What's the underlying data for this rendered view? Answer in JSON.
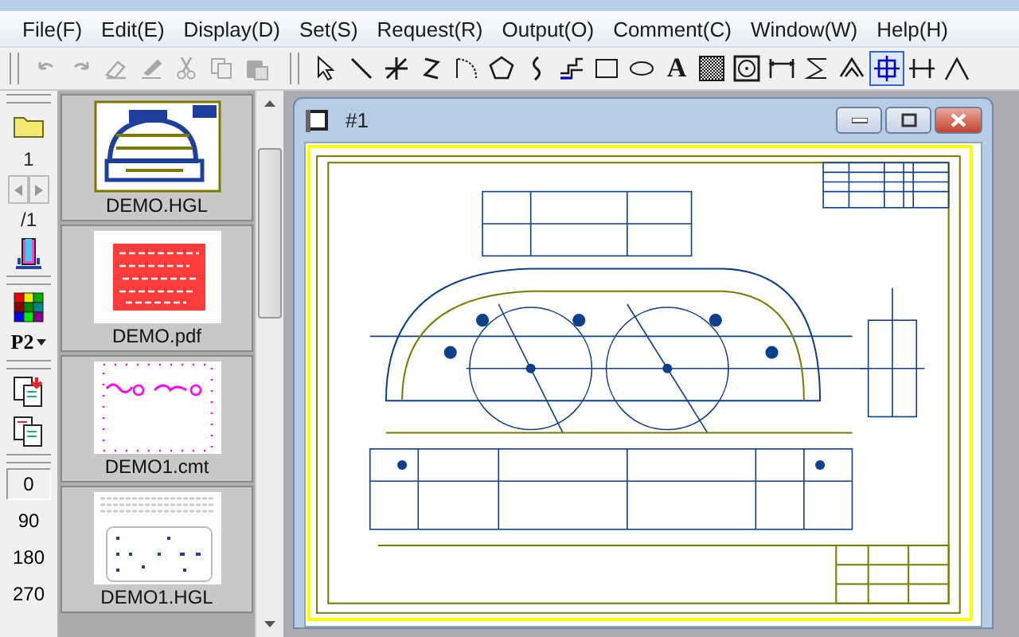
{
  "menu_bar": [
    {
      "label": "File(F)"
    },
    {
      "label": "Edit(E)"
    },
    {
      "label": "Display(D)"
    },
    {
      "label": "Set(S)"
    },
    {
      "label": "Request(R)"
    },
    {
      "label": "Output(O)"
    },
    {
      "label": "Comment(C)"
    },
    {
      "label": "Window(W)"
    },
    {
      "label": "Help(H)"
    }
  ],
  "edit_toolbar": [
    {
      "kind": "undo",
      "disabled": true
    },
    {
      "kind": "redo",
      "disabled": true
    },
    {
      "kind": "eraser",
      "disabled": true
    },
    {
      "kind": "pen",
      "disabled": true
    },
    {
      "kind": "cut",
      "disabled": true
    },
    {
      "kind": "copy",
      "disabled": true
    },
    {
      "kind": "paste",
      "disabled": true
    }
  ],
  "draw_toolbar": [
    {
      "kind": "pointer",
      "selected": false
    },
    {
      "kind": "line",
      "selected": false
    },
    {
      "kind": "star",
      "selected": false
    },
    {
      "kind": "zigzag",
      "selected": false
    },
    {
      "kind": "arc",
      "selected": false
    },
    {
      "kind": "pentagon",
      "selected": false
    },
    {
      "kind": "curve",
      "selected": false
    },
    {
      "kind": "steps",
      "selected": false
    },
    {
      "kind": "rect",
      "selected": false
    },
    {
      "kind": "ellipse",
      "selected": false
    },
    {
      "kind": "text",
      "glyph": "A",
      "selected": false
    },
    {
      "kind": "hatch",
      "selected": false
    },
    {
      "kind": "circle",
      "selected": false
    },
    {
      "kind": "dimension",
      "selected": false
    },
    {
      "kind": "angle",
      "selected": false
    },
    {
      "kind": "peak",
      "selected": false
    },
    {
      "kind": "crosshair",
      "selected": true
    },
    {
      "kind": "ticks",
      "selected": false
    },
    {
      "kind": "caret",
      "selected": false
    }
  ],
  "side_toolbar": {
    "page": "1",
    "page_total": "/1",
    "pen": "P2",
    "rotations": [
      {
        "label": "0",
        "selected": true
      },
      {
        "label": "90",
        "selected": false
      },
      {
        "label": "180",
        "selected": false
      },
      {
        "label": "270",
        "selected": false
      }
    ]
  },
  "thumbnails": [
    {
      "name": "DEMO.HGL",
      "kind": "plot"
    },
    {
      "name": "DEMO.pdf",
      "kind": "pdf"
    },
    {
      "name": "DEMO1.cmt",
      "kind": "comment"
    },
    {
      "name": "DEMO1.HGL",
      "kind": "sheet"
    }
  ],
  "document_window": {
    "title": "#1"
  }
}
